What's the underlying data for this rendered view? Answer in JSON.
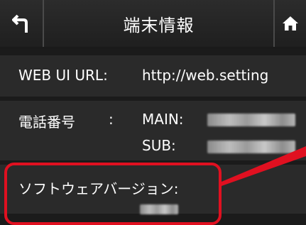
{
  "header": {
    "title": "端末情報",
    "back_icon": "back-arrow-icon",
    "home_icon": "home-icon"
  },
  "webui": {
    "label": "WEB UI URL:",
    "value": "http://web.setting"
  },
  "phone": {
    "label": "電話番号",
    "separator": ":",
    "main_label": "MAIN:",
    "sub_label": "SUB:"
  },
  "software": {
    "label": "ソフトウェアバージョン:"
  },
  "colors": {
    "highlight": "#e01020",
    "background": "#1b1b1b",
    "row": "#2a2a2a"
  }
}
